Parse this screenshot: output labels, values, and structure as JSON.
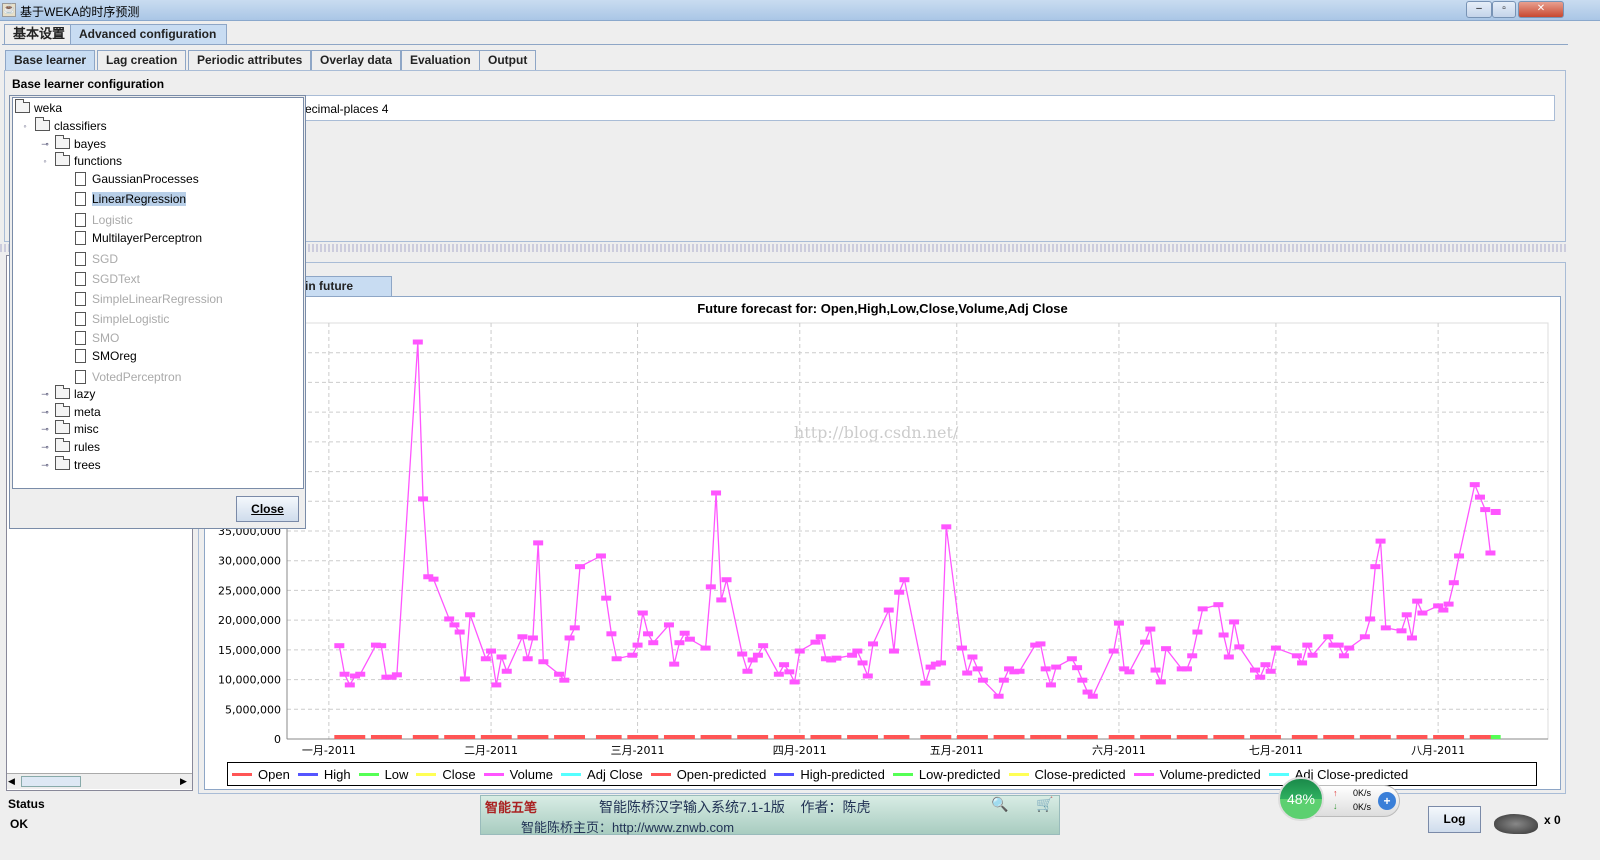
{
  "window": {
    "title": "基于WEKA的时序预测",
    "minimize": "‒",
    "maximize": "▫",
    "close": "✕"
  },
  "top_tabs": [
    {
      "label": "基本设置",
      "selected": false
    },
    {
      "label": "Advanced configuration",
      "selected": true
    }
  ],
  "sub_tabs": [
    {
      "label": "Base learner",
      "selected": true
    },
    {
      "label": "Lag creation"
    },
    {
      "label": "Periodic attributes"
    },
    {
      "label": "Overlay data"
    },
    {
      "label": "Evaluation"
    },
    {
      "label": "Output"
    }
  ],
  "base_learner": {
    "group_title": "Base learner configuration",
    "field_value": "ecimal-places 4"
  },
  "tree": {
    "items": [
      {
        "label": "weka",
        "level": 0,
        "type": "folder"
      },
      {
        "label": "classifiers",
        "level": 1,
        "type": "folder",
        "expanded": true
      },
      {
        "label": "bayes",
        "level": 2,
        "type": "folder"
      },
      {
        "label": "functions",
        "level": 2,
        "type": "folder",
        "expanded": true
      },
      {
        "label": "GaussianProcesses",
        "level": 3,
        "type": "leaf"
      },
      {
        "label": "LinearRegression",
        "level": 3,
        "type": "leaf",
        "selected": true
      },
      {
        "label": "Logistic",
        "level": 3,
        "type": "leaf",
        "disabled": true
      },
      {
        "label": "MultilayerPerceptron",
        "level": 3,
        "type": "leaf"
      },
      {
        "label": "SGD",
        "level": 3,
        "type": "leaf",
        "disabled": true
      },
      {
        "label": "SGDText",
        "level": 3,
        "type": "leaf",
        "disabled": true
      },
      {
        "label": "SimpleLinearRegression",
        "level": 3,
        "type": "leaf",
        "disabled": true
      },
      {
        "label": "SimpleLogistic",
        "level": 3,
        "type": "leaf",
        "disabled": true
      },
      {
        "label": "SMO",
        "level": 3,
        "type": "leaf",
        "disabled": true
      },
      {
        "label": "SMOreg",
        "level": 3,
        "type": "leaf"
      },
      {
        "label": "VotedPerceptron",
        "level": 3,
        "type": "leaf",
        "disabled": true
      },
      {
        "label": "lazy",
        "level": 2,
        "type": "folder"
      },
      {
        "label": "meta",
        "level": 2,
        "type": "folder"
      },
      {
        "label": "misc",
        "level": 2,
        "type": "folder"
      },
      {
        "label": "rules",
        "level": 2,
        "type": "folder"
      },
      {
        "label": "trees",
        "level": 2,
        "type": "folder"
      }
    ],
    "close_label": "Close"
  },
  "output_tab": {
    "label": "in future pred."
  },
  "chart_data": {
    "type": "line",
    "title": "Future forecast for: Open,High,Low,Close,Volume,Adj Close",
    "xlabel": "",
    "ylabel": "",
    "ylim": [
      0,
      70000000
    ],
    "yticks": [
      0,
      5000000,
      10000000,
      15000000,
      20000000,
      25000000,
      30000000,
      35000000,
      40000000,
      45000000,
      50000000,
      55000000,
      60000000,
      65000000
    ],
    "ytick_labels": [
      "0",
      "5,000,000",
      "10,000,000",
      "15,000,000",
      "20,000,000",
      "25,000,000",
      "30,000,000",
      "35,000,000",
      "40,000,000",
      "45,000,000",
      "50,000,000",
      "55,000,000",
      "60,000,000",
      "65,000,000"
    ],
    "xlim": [
      "2010-12-24",
      "2011-08-22"
    ],
    "xticks": [
      "2011-01-01",
      "2011-02-01",
      "2011-03-01",
      "2011-04-01",
      "2011-05-01",
      "2011-06-01",
      "2011-07-01",
      "2011-08-01"
    ],
    "xtick_labels": [
      "一月-2011",
      "二月-2011",
      "三月-2011",
      "四月-2011",
      "五月-2011",
      "六月-2011",
      "七月-2011",
      "八月-2011"
    ],
    "grid": true,
    "watermark": "http://blog.csdn.net/",
    "legend_placement": "bottom",
    "legend": [
      {
        "name": "Open",
        "color": "#ff5555"
      },
      {
        "name": "High",
        "color": "#5555ff"
      },
      {
        "name": "Low",
        "color": "#55ff55"
      },
      {
        "name": "Close",
        "color": "#ffff55"
      },
      {
        "name": "Volume",
        "color": "#ff55ff"
      },
      {
        "name": "Adj Close",
        "color": "#55ffff"
      },
      {
        "name": "Open-predicted",
        "color": "#ff5555"
      },
      {
        "name": "High-predicted",
        "color": "#5555ff"
      },
      {
        "name": "Low-predicted",
        "color": "#55ff55"
      },
      {
        "name": "Close-predicted",
        "color": "#ffff55"
      },
      {
        "name": "Volume-predicted",
        "color": "#ff55ff"
      },
      {
        "name": "Adj Close-predicted",
        "color": "#55ffff"
      }
    ],
    "near_zero_series": [
      "Open",
      "High",
      "Low",
      "Close",
      "Adj Close"
    ],
    "volume": {
      "dates": [
        "2011-01-03",
        "2011-01-04",
        "2011-01-05",
        "2011-01-06",
        "2011-01-07",
        "2011-01-10",
        "2011-01-11",
        "2011-01-12",
        "2011-01-13",
        "2011-01-14",
        "2011-01-18",
        "2011-01-19",
        "2011-01-20",
        "2011-01-21",
        "2011-01-24",
        "2011-01-25",
        "2011-01-26",
        "2011-01-27",
        "2011-01-28",
        "2011-01-31",
        "2011-02-01",
        "2011-02-02",
        "2011-02-03",
        "2011-02-04",
        "2011-02-07",
        "2011-02-08",
        "2011-02-09",
        "2011-02-10",
        "2011-02-11",
        "2011-02-14",
        "2011-02-15",
        "2011-02-16",
        "2011-02-17",
        "2011-02-18",
        "2011-02-22",
        "2011-02-23",
        "2011-02-24",
        "2011-02-25",
        "2011-02-28",
        "2011-03-01",
        "2011-03-02",
        "2011-03-03",
        "2011-03-04",
        "2011-03-07",
        "2011-03-08",
        "2011-03-09",
        "2011-03-10",
        "2011-03-11",
        "2011-03-14",
        "2011-03-15",
        "2011-03-16",
        "2011-03-17",
        "2011-03-18",
        "2011-03-21",
        "2011-03-22",
        "2011-03-23",
        "2011-03-24",
        "2011-03-25",
        "2011-03-28",
        "2011-03-29",
        "2011-03-30",
        "2011-03-31",
        "2011-04-01",
        "2011-04-04",
        "2011-04-05",
        "2011-04-06",
        "2011-04-07",
        "2011-04-08",
        "2011-04-11",
        "2011-04-12",
        "2011-04-13",
        "2011-04-14",
        "2011-04-15",
        "2011-04-18",
        "2011-04-19",
        "2011-04-20",
        "2011-04-21",
        "2011-04-25",
        "2011-04-26",
        "2011-04-27",
        "2011-04-28",
        "2011-04-29",
        "2011-05-02",
        "2011-05-03",
        "2011-05-04",
        "2011-05-05",
        "2011-05-06",
        "2011-05-09",
        "2011-05-10",
        "2011-05-11",
        "2011-05-12",
        "2011-05-13",
        "2011-05-16",
        "2011-05-17",
        "2011-05-18",
        "2011-05-19",
        "2011-05-20",
        "2011-05-23",
        "2011-05-24",
        "2011-05-25",
        "2011-05-26",
        "2011-05-27",
        "2011-05-31",
        "2011-06-01",
        "2011-06-02",
        "2011-06-03",
        "2011-06-06",
        "2011-06-07",
        "2011-06-08",
        "2011-06-09",
        "2011-06-10",
        "2011-06-13",
        "2011-06-14",
        "2011-06-15",
        "2011-06-16",
        "2011-06-17",
        "2011-06-20",
        "2011-06-21",
        "2011-06-22",
        "2011-06-23",
        "2011-06-24",
        "2011-06-27",
        "2011-06-28",
        "2011-06-29",
        "2011-06-30",
        "2011-07-01",
        "2011-07-05",
        "2011-07-06",
        "2011-07-07",
        "2011-07-08",
        "2011-07-11",
        "2011-07-12",
        "2011-07-13",
        "2011-07-14",
        "2011-07-15",
        "2011-07-18",
        "2011-07-19",
        "2011-07-20",
        "2011-07-21",
        "2011-07-22",
        "2011-07-25",
        "2011-07-26",
        "2011-07-27",
        "2011-07-28",
        "2011-07-29",
        "2011-08-01",
        "2011-08-02",
        "2011-08-03",
        "2011-08-04",
        "2011-08-05",
        "2011-08-08",
        "2011-08-09",
        "2011-08-10",
        "2011-08-11"
      ],
      "values": [
        15700000,
        10900000,
        9100000,
        10600000,
        10900000,
        15800000,
        15700000,
        10400000,
        10400000,
        10800000,
        66800000,
        40400000,
        27300000,
        26900000,
        20200000,
        19200000,
        18000000,
        10100000,
        20900000,
        13500000,
        14800000,
        9100000,
        13800000,
        11400000,
        17200000,
        13500000,
        17000000,
        33000000,
        13000000,
        10900000,
        9900000,
        17000000,
        18700000,
        29000000,
        30800000,
        23700000,
        17700000,
        13500000,
        14100000,
        15800000,
        21200000,
        17700000,
        16200000,
        19200000,
        12600000,
        16200000,
        17800000,
        16800000,
        15300000,
        25600000,
        41400000,
        23400000,
        26800000,
        14300000,
        11400000,
        13300000,
        14100000,
        15700000,
        10900000,
        12500000,
        11300000,
        9600000,
        14800000,
        16300000,
        17200000,
        13500000,
        13300000,
        13600000,
        14100000,
        14800000,
        12800000,
        10600000,
        16000000,
        21700000,
        14800000,
        24700000,
        26800000,
        9400000,
        12100000,
        12600000,
        12800000,
        35700000,
        15300000,
        11100000,
        13800000,
        11800000,
        9900000,
        7200000,
        9900000,
        11800000,
        11300000,
        11400000,
        15800000,
        16000000,
        11800000,
        9100000,
        12100000,
        13500000,
        12000000,
        9900000,
        7900000,
        7200000,
        14800000,
        19500000,
        11800000,
        11300000,
        16300000,
        18500000,
        11600000,
        9600000,
        15200000,
        11800000,
        11800000,
        14000000,
        18000000,
        21900000,
        22600000,
        17500000,
        13800000,
        19700000,
        15500000,
        11600000,
        10400000,
        12500000,
        11400000,
        15300000,
        14000000,
        12800000,
        15800000,
        14100000,
        17200000,
        15800000,
        15800000,
        14000000,
        15300000,
        17200000,
        20200000,
        29000000,
        33300000,
        18700000,
        18200000,
        20900000,
        17000000,
        23200000,
        21200000,
        22400000,
        21700000,
        22700000,
        26300000,
        30800000,
        42800000,
        40700000,
        38600000,
        31300000
      ],
      "predicted": {
        "dates": [
          "2011-08-12"
        ],
        "values": [
          38200000
        ]
      }
    }
  },
  "status": {
    "title": "Status",
    "text": "OK",
    "log_label": "Log",
    "count": "x 0"
  },
  "ime": {
    "line1": "智能陈桥汉字输入系统7.1-1版    作者：陈虎",
    "line2": "智能陈桥主页：http://www.znwb.com",
    "logo": "智能五笔"
  },
  "net_widget": {
    "percent": "48%",
    "up": "0K/s",
    "down": "0K/s"
  }
}
